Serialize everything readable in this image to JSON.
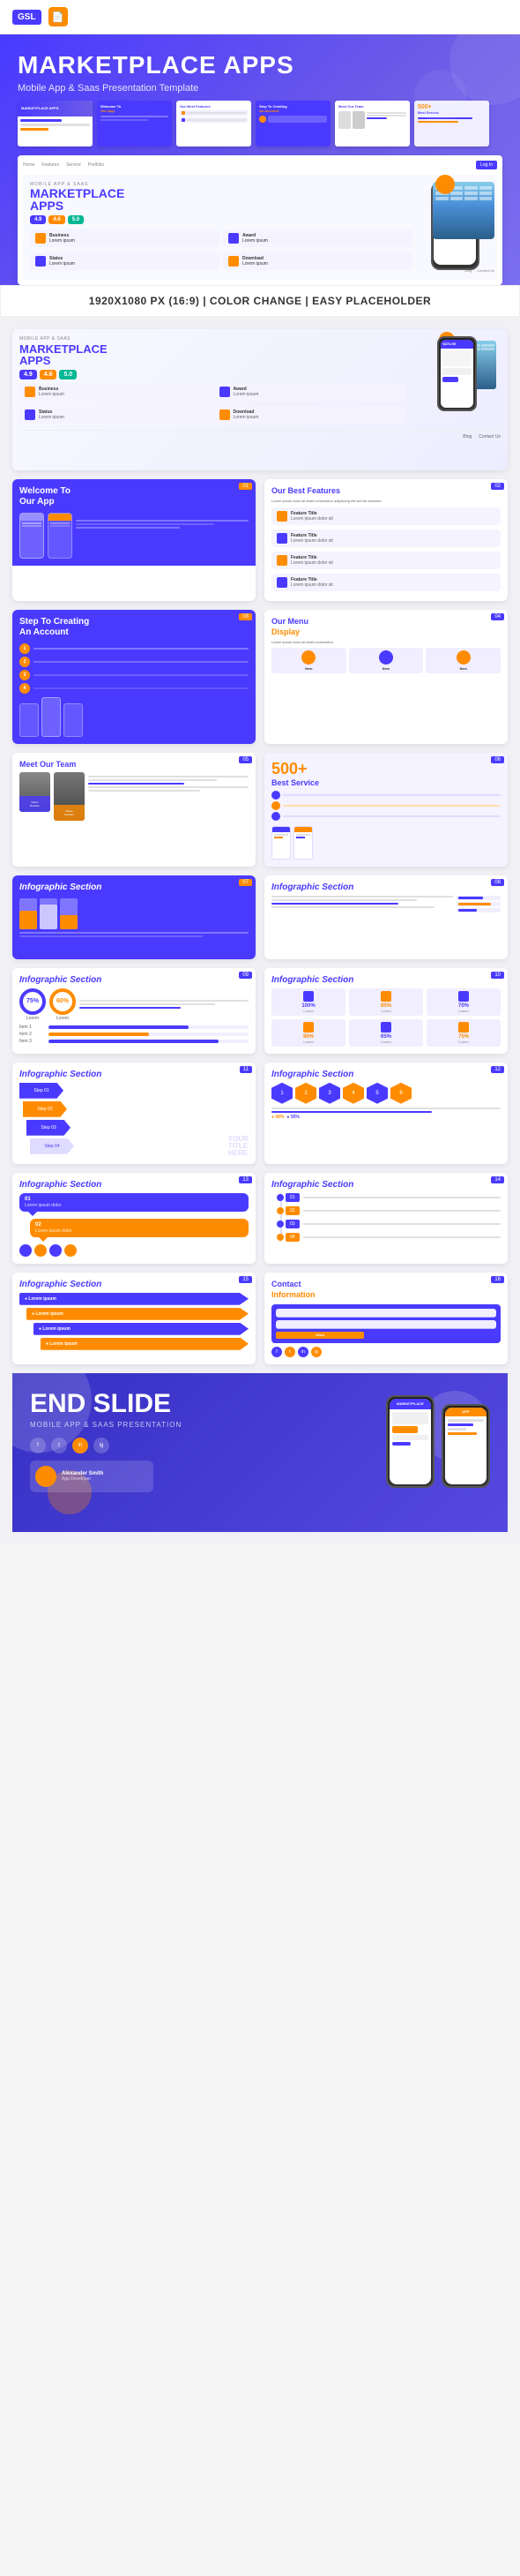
{
  "header": {
    "gsl_label": "GSL",
    "icon_char": "📄"
  },
  "hero": {
    "title": "MARKETPLACE APPS",
    "subtitle": "Mobile App & Saas Presentation Template",
    "dimension_bar": "1920X1080 PX (16:9) | COLOR CHANGE | EASY PLACEHOLDER"
  },
  "slides": [
    {
      "id": "hero-main",
      "type": "hero",
      "label": "MOBILE APP & SAAS",
      "title": "MARKETPLACE APPS",
      "subtitle": "Mobile App & Saas Presentation Template",
      "ratings": [
        "4.9",
        "4.6",
        "5.0"
      ],
      "features": [
        "Business",
        "Award",
        "Lorem ipsum",
        "Lorem ipsum",
        "Status",
        "Download",
        "Lorem ipsum",
        "Lorem ipsum"
      ]
    },
    {
      "id": "welcome",
      "type": "purple",
      "title": "Welcome To Our App",
      "badge": "01"
    },
    {
      "id": "features",
      "type": "white",
      "title": "Our Best Features",
      "badge": "02"
    },
    {
      "id": "steps",
      "type": "purple",
      "title": "Step To Creating An Account",
      "badge": "03"
    },
    {
      "id": "menu",
      "type": "white",
      "title": "Our Menu Display",
      "badge": "04"
    },
    {
      "id": "team",
      "type": "white",
      "title": "Meet Our Team",
      "badge": "05"
    },
    {
      "id": "service",
      "type": "purple",
      "title": "Best Service",
      "badge": "06",
      "stat": "500+"
    },
    {
      "id": "infographic1",
      "type": "white",
      "title": "Infographic Section",
      "badge": "07"
    },
    {
      "id": "infographic2",
      "type": "white",
      "title": "Infographic Section",
      "badge": "08"
    },
    {
      "id": "infographic3",
      "type": "white",
      "title": "Infographic Section",
      "badge": "09"
    },
    {
      "id": "infographic4",
      "type": "white",
      "title": "Infographic Section",
      "badge": "10"
    },
    {
      "id": "infographic5",
      "type": "white",
      "title": "Infographic Section",
      "badge": "11"
    },
    {
      "id": "infographic6",
      "type": "white",
      "title": "Infographic Section",
      "badge": "12"
    },
    {
      "id": "infographic7",
      "type": "white",
      "title": "Infographic Section",
      "badge": "13"
    },
    {
      "id": "infographic8",
      "type": "white",
      "title": "Infographic Section",
      "badge": "14"
    },
    {
      "id": "infographic9",
      "type": "white",
      "title": "Infographic Section",
      "badge": "15"
    },
    {
      "id": "contact",
      "type": "white",
      "title": "Contact Information",
      "badge": "16"
    },
    {
      "id": "end",
      "type": "end",
      "title": "END SLIDE",
      "subtitle": "MOBILE APP & SAAS PRESENTATION"
    }
  ],
  "colors": {
    "purple": "#4a3aff",
    "orange": "#ff8c00",
    "light_purple": "#f5f3ff",
    "text": "#333",
    "muted": "#888"
  }
}
